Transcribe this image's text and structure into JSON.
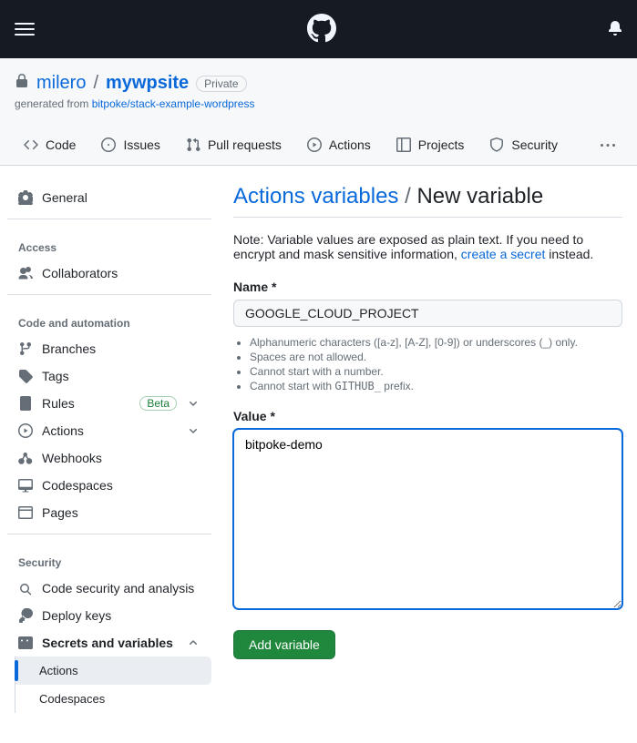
{
  "header": {},
  "repo": {
    "owner": "milero",
    "name": "mywpsite",
    "visibility": "Private",
    "generated_prefix": "generated from ",
    "generated_link": "bitpoke/stack-example-wordpress"
  },
  "repo_nav": {
    "code": "Code",
    "issues": "Issues",
    "pulls": "Pull requests",
    "actions": "Actions",
    "projects": "Projects",
    "security": "Security"
  },
  "sidebar": {
    "general": "General",
    "section_access": "Access",
    "collaborators": "Collaborators",
    "section_code": "Code and automation",
    "branches": "Branches",
    "tags": "Tags",
    "rules": "Rules",
    "rules_badge": "Beta",
    "actions": "Actions",
    "webhooks": "Webhooks",
    "codespaces": "Codespaces",
    "pages": "Pages",
    "section_security": "Security",
    "code_security": "Code security and analysis",
    "deploy_keys": "Deploy keys",
    "secrets_vars": "Secrets and variables",
    "sv_actions": "Actions",
    "sv_codespaces": "Codespaces"
  },
  "main": {
    "crumb_link": "Actions variables",
    "crumb_sep": " / ",
    "crumb_current": "New variable",
    "note_prefix": "Note: Variable values are exposed as plain text. If you need to encrypt and mask sensitive information, ",
    "note_link": "create a secret",
    "note_suffix": " instead.",
    "name_label": "Name *",
    "name_value": "GOOGLE_CLOUD_PROJECT",
    "hint1": "Alphanumeric characters ([a-z], [A-Z], [0-9]) or underscores (_) only.",
    "hint2": "Spaces are not allowed.",
    "hint3": "Cannot start with a number.",
    "hint4_a": "Cannot start with ",
    "hint4_code": "GITHUB_",
    "hint4_b": " prefix.",
    "value_label": "Value *",
    "value_value": "bitpoke-demo",
    "submit": "Add variable"
  }
}
